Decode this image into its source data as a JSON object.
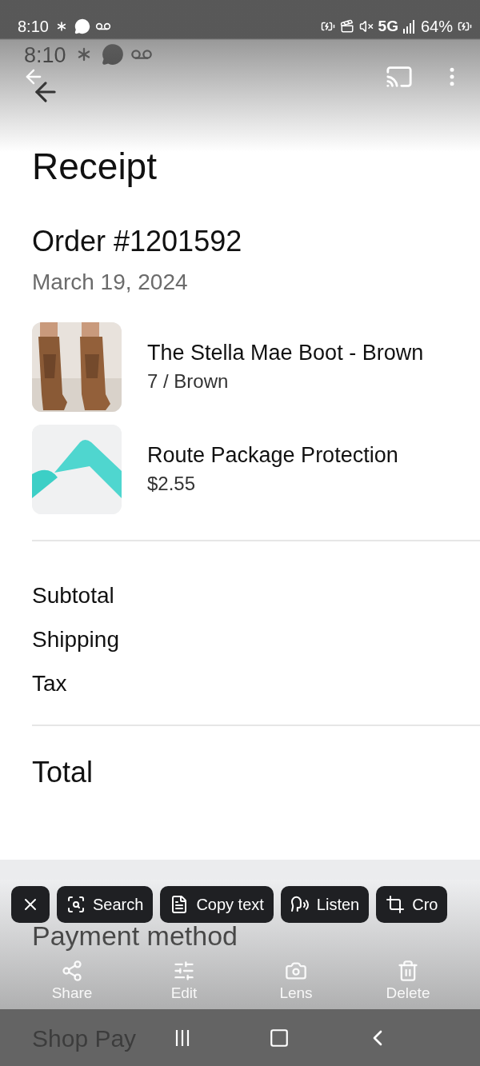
{
  "outer_status_bar": {
    "time": "8:10",
    "network": "5G",
    "battery": "64%"
  },
  "inner_status_bar": {
    "time": "8:10"
  },
  "receipt": {
    "title": "Receipt",
    "order": "Order #1201592",
    "date": "March 19, 2024",
    "items": [
      {
        "kind": "picture",
        "name": "The Stella Mae Boot - Brown",
        "detail": "7 / Brown"
      },
      {
        "kind": "logo",
        "name": "Route Package Protection",
        "detail": "$2.55"
      }
    ],
    "summary": [
      "Subtotal",
      "Shipping",
      "Tax"
    ],
    "total": "Total",
    "payment_heading": "Payment method",
    "payment_method": "Shop Pay"
  },
  "quick_actions": [
    {
      "kind": "close"
    },
    {
      "kind": "search",
      "label": "Search"
    },
    {
      "kind": "copy",
      "label": "Copy text"
    },
    {
      "kind": "listen",
      "label": "Listen"
    },
    {
      "kind": "crop",
      "label": "Cro"
    }
  ],
  "viewer_actions": [
    {
      "kind": "share",
      "label": "Share"
    },
    {
      "kind": "edit",
      "label": "Edit"
    },
    {
      "kind": "lens",
      "label": "Lens"
    },
    {
      "kind": "delete",
      "label": "Delete"
    }
  ]
}
